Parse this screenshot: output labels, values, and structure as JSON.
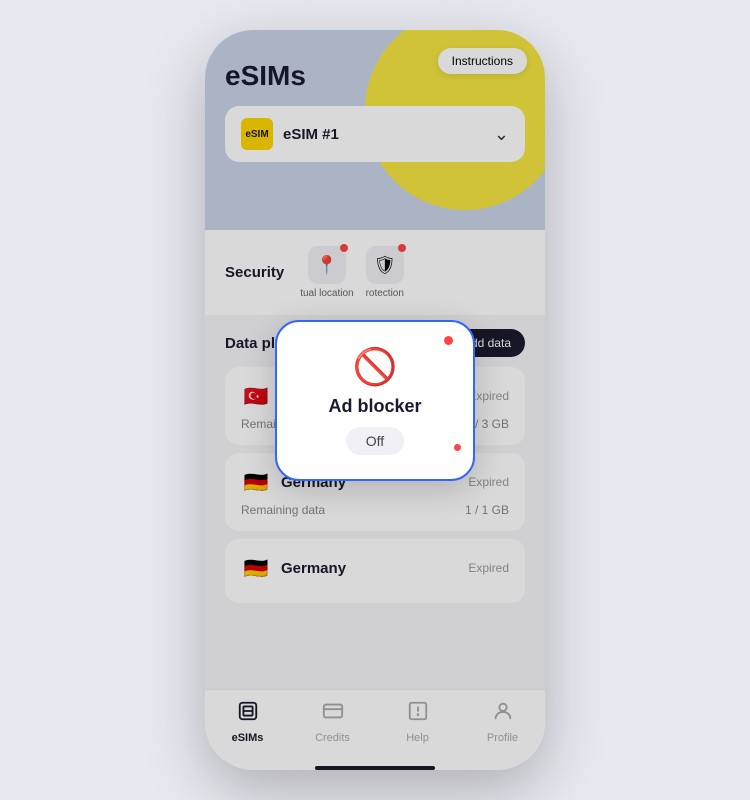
{
  "phone": {
    "header": {
      "title": "eSIMs",
      "instructions_label": "Instructions",
      "esim_selector_label": "eSIM #1"
    },
    "security": {
      "label": "Security",
      "features": [
        {
          "id": "virtual-location",
          "label": "tual location",
          "has_dot": true
        },
        {
          "id": "protection",
          "label": "rotection",
          "has_dot": true
        }
      ]
    },
    "data_plans": {
      "title": "Data plans",
      "add_data_label": "+ Add data",
      "plans": [
        {
          "country": "Turkey",
          "flag_emoji": "🇹🇷",
          "status": "Expired",
          "remaining_label": "Remaining data",
          "data_amount": "1.3 / 3 GB"
        },
        {
          "country": "Germany",
          "flag_emoji": "🇩🇪",
          "status": "Expired",
          "remaining_label": "Remaining data",
          "data_amount": "1 / 1 GB"
        },
        {
          "country": "Germany",
          "flag_emoji": "🇩🇪",
          "status": "Expired",
          "remaining_label": "",
          "data_amount": ""
        }
      ]
    },
    "ad_blocker_popup": {
      "title": "Ad blocker",
      "status": "Off"
    },
    "bottom_nav": {
      "items": [
        {
          "id": "esims",
          "label": "eSIMs",
          "active": true
        },
        {
          "id": "credits",
          "label": "Credits",
          "active": false
        },
        {
          "id": "help",
          "label": "Help",
          "active": false
        },
        {
          "id": "profile",
          "label": "Profile",
          "active": false
        }
      ]
    }
  }
}
